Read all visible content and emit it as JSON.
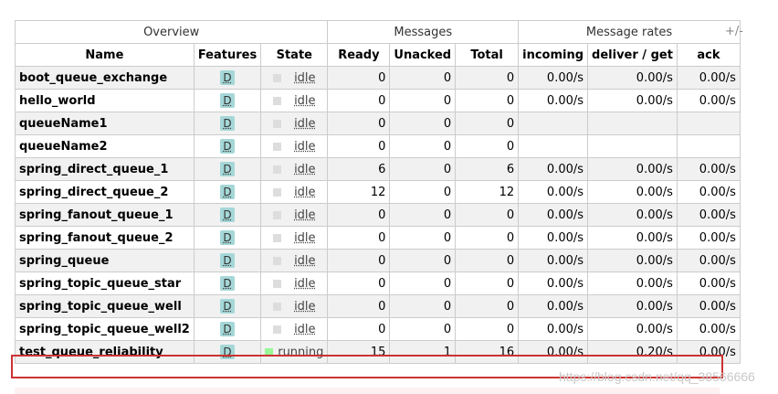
{
  "header": {
    "groups": [
      "Overview",
      "Messages",
      "Message rates"
    ],
    "plusminus": "+/-",
    "columns": [
      "Name",
      "Features",
      "State",
      "Ready",
      "Unacked",
      "Total",
      "incoming",
      "deliver / get",
      "ack"
    ]
  },
  "rows": [
    {
      "name": "boot_queue_exchange",
      "feature": "D",
      "state": "idle",
      "ready": "0",
      "unacked": "0",
      "total": "0",
      "incoming": "0.00/s",
      "deliver": "0.00/s",
      "ack": "0.00/s"
    },
    {
      "name": "hello_world",
      "feature": "D",
      "state": "idle",
      "ready": "0",
      "unacked": "0",
      "total": "0",
      "incoming": "0.00/s",
      "deliver": "0.00/s",
      "ack": "0.00/s"
    },
    {
      "name": "queueName1",
      "feature": "D",
      "state": "idle",
      "ready": "0",
      "unacked": "0",
      "total": "0",
      "incoming": "",
      "deliver": "",
      "ack": ""
    },
    {
      "name": "queueName2",
      "feature": "D",
      "state": "idle",
      "ready": "0",
      "unacked": "0",
      "total": "0",
      "incoming": "",
      "deliver": "",
      "ack": ""
    },
    {
      "name": "spring_direct_queue_1",
      "feature": "D",
      "state": "idle",
      "ready": "6",
      "unacked": "0",
      "total": "6",
      "incoming": "0.00/s",
      "deliver": "0.00/s",
      "ack": "0.00/s"
    },
    {
      "name": "spring_direct_queue_2",
      "feature": "D",
      "state": "idle",
      "ready": "12",
      "unacked": "0",
      "total": "12",
      "incoming": "0.00/s",
      "deliver": "0.00/s",
      "ack": "0.00/s"
    },
    {
      "name": "spring_fanout_queue_1",
      "feature": "D",
      "state": "idle",
      "ready": "0",
      "unacked": "0",
      "total": "0",
      "incoming": "0.00/s",
      "deliver": "0.00/s",
      "ack": "0.00/s"
    },
    {
      "name": "spring_fanout_queue_2",
      "feature": "D",
      "state": "idle",
      "ready": "0",
      "unacked": "0",
      "total": "0",
      "incoming": "0.00/s",
      "deliver": "0.00/s",
      "ack": "0.00/s"
    },
    {
      "name": "spring_queue",
      "feature": "D",
      "state": "idle",
      "ready": "0",
      "unacked": "0",
      "total": "0",
      "incoming": "0.00/s",
      "deliver": "0.00/s",
      "ack": "0.00/s"
    },
    {
      "name": "spring_topic_queue_star",
      "feature": "D",
      "state": "idle",
      "ready": "0",
      "unacked": "0",
      "total": "0",
      "incoming": "0.00/s",
      "deliver": "0.00/s",
      "ack": "0.00/s"
    },
    {
      "name": "spring_topic_queue_well",
      "feature": "D",
      "state": "idle",
      "ready": "0",
      "unacked": "0",
      "total": "0",
      "incoming": "0.00/s",
      "deliver": "0.00/s",
      "ack": "0.00/s"
    },
    {
      "name": "spring_topic_queue_well2",
      "feature": "D",
      "state": "idle",
      "ready": "0",
      "unacked": "0",
      "total": "0",
      "incoming": "0.00/s",
      "deliver": "0.00/s",
      "ack": "0.00/s"
    },
    {
      "name": "test_queue_reliability",
      "feature": "D",
      "state": "running",
      "ready": "15",
      "unacked": "1",
      "total": "16",
      "incoming": "0.00/s",
      "deliver": "0.20/s",
      "ack": "0.00/s"
    }
  ],
  "watermark": "https://blog.csdn.net/qq_38566666",
  "colors": {
    "feature_badge": "#a5d7d8",
    "idle_square": "#dddddd",
    "running_square": "#98f898",
    "highlight": "#cc3333"
  }
}
